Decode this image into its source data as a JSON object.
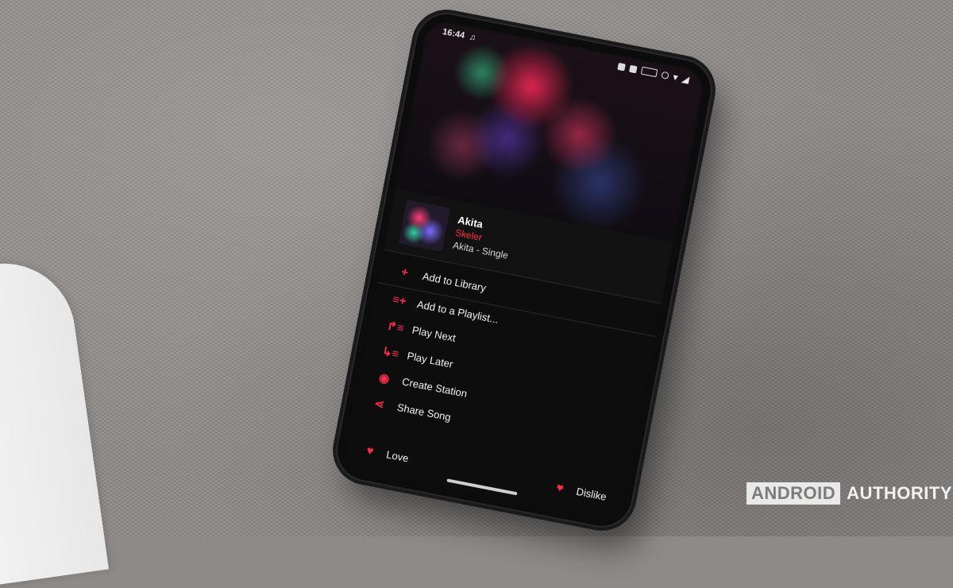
{
  "status_bar": {
    "time": "16:44",
    "battery": ""
  },
  "now_playing": {
    "title": "Akita",
    "artist": "Skeler",
    "album": "Akita - Single"
  },
  "menu": [
    {
      "label": "Add to Library",
      "icon": "plus-icon",
      "glyph": "+"
    },
    {
      "label": "Add to a Playlist...",
      "icon": "add-playlist-icon",
      "glyph": "≡+"
    },
    {
      "label": "Play Next",
      "icon": "play-next-icon",
      "glyph": "↱≡"
    },
    {
      "label": "Play Later",
      "icon": "play-later-icon",
      "glyph": "↳≡"
    },
    {
      "label": "Create Station",
      "icon": "station-icon",
      "glyph": "◉"
    },
    {
      "label": "Share Song",
      "icon": "share-icon",
      "glyph": "⋖"
    }
  ],
  "love": {
    "label": "Love",
    "icon": "heart-icon",
    "glyph": "♥"
  },
  "dislike": {
    "label": "Dislike",
    "icon": "dislike-icon",
    "glyph": "♥"
  },
  "accent_color": "#fa2d48",
  "watermark": {
    "brand1": "ANDROID",
    "brand2": "AUTHORITY"
  }
}
